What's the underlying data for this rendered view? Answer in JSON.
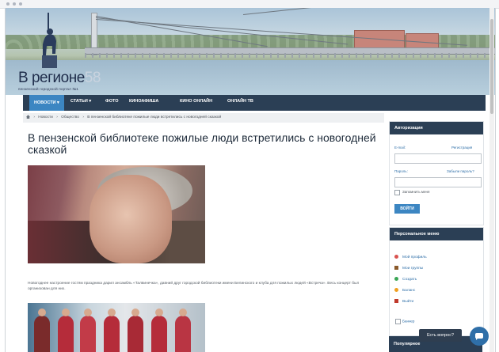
{
  "site": {
    "logo_text": "В регионе",
    "logo_number": "58",
    "logo_tagline": "пензенский городской портал №1"
  },
  "nav": {
    "items": [
      {
        "label": "НОВОСТИ ▾",
        "active": true
      },
      {
        "label": "СТАТЬИ ▾",
        "active": false
      },
      {
        "label": "ФОТО",
        "active": false
      },
      {
        "label": "КИНОАФИША",
        "active": false
      },
      {
        "label": "КИНО ОНЛАЙН",
        "active": false
      },
      {
        "label": "ОНЛАЙН ТВ",
        "active": false
      }
    ]
  },
  "breadcrumb": {
    "items": [
      "Новости",
      "Общество",
      "В пензенской библиотеке пожилые люди встретились с новогодней сказкой"
    ]
  },
  "article": {
    "title": "В пензенской библиотеке пожилые люди встретились с новогодней сказкой",
    "caption": "Новогоднее настроение гостям праздника дарил ансамбль «Талвинечка», давний друг городской библиотеки имени Белинского и клуба для пожилых людей «Встреча». Весь концерт был организован для них."
  },
  "login": {
    "header": "Авторизация",
    "email_label": "E-mail:",
    "register_link": "Регистрация",
    "password_label": "Пароль:",
    "forgot_link": "Забыли пароль?",
    "remember_label": "Запомнить меня",
    "submit_label": "ВОЙТИ"
  },
  "personal_menu": {
    "header": "Персональное меню",
    "items": [
      {
        "label": "Мой профиль",
        "color": "#d9534f"
      },
      {
        "label": "Мои группы",
        "color": "#8b5a2b"
      },
      {
        "label": "Создать",
        "color": "#3aa655"
      },
      {
        "label": "Баланс",
        "color": "#f0a020"
      },
      {
        "label": "Выйти",
        "color": "#c0392b"
      }
    ],
    "banner_alt": "Баннер"
  },
  "popular": {
    "header": "Популярное"
  },
  "chat": {
    "label": "Есть вопрос?"
  },
  "colors": {
    "nav_bg": "#2b3f55",
    "accent": "#3c86c2",
    "link": "#2f6fa8"
  }
}
